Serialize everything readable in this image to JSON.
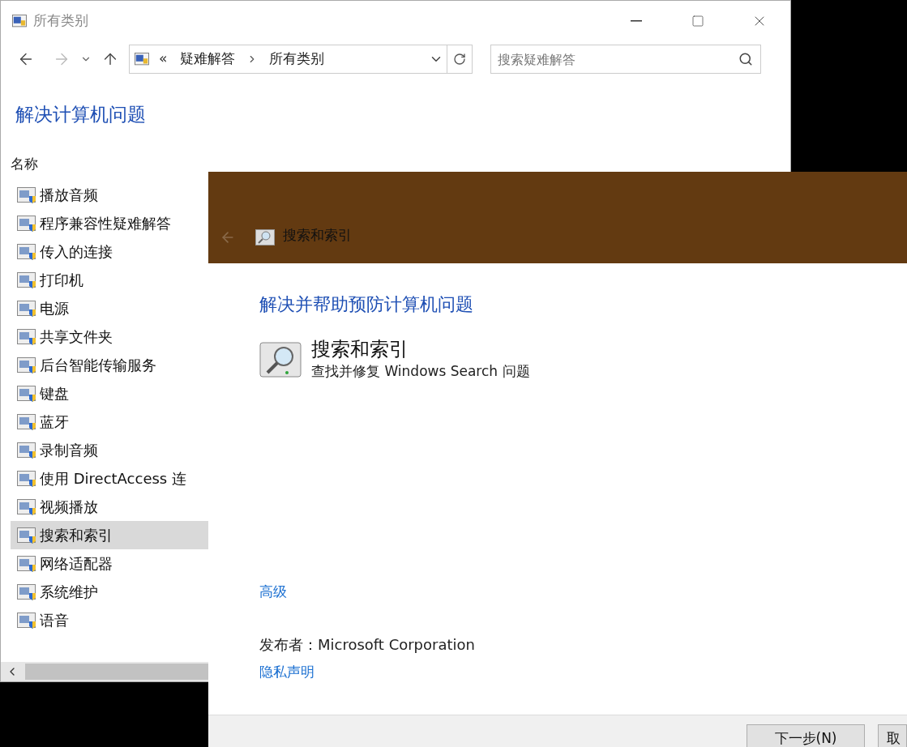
{
  "back_window": {
    "title": "所有类别",
    "address": {
      "overflow": "«",
      "crumbs": [
        "疑难解答",
        "所有类别"
      ]
    },
    "search": {
      "placeholder": "搜索疑难解答"
    },
    "heading": "解决计算机问题",
    "column": "名称",
    "items": [
      {
        "label": "播放音频",
        "selected": false
      },
      {
        "label": "程序兼容性疑难解答",
        "selected": false
      },
      {
        "label": "传入的连接",
        "selected": false
      },
      {
        "label": "打印机",
        "selected": false
      },
      {
        "label": "电源",
        "selected": false
      },
      {
        "label": "共享文件夹",
        "selected": false
      },
      {
        "label": "后台智能传输服务",
        "selected": false
      },
      {
        "label": "键盘",
        "selected": false
      },
      {
        "label": "蓝牙",
        "selected": false
      },
      {
        "label": "录制音频",
        "selected": false
      },
      {
        "label": "使用 DirectAccess 连",
        "selected": false
      },
      {
        "label": "视频播放",
        "selected": false
      },
      {
        "label": "搜索和索引",
        "selected": true
      },
      {
        "label": "网络适配器",
        "selected": false
      },
      {
        "label": "系统维护",
        "selected": false
      },
      {
        "label": "语音",
        "selected": false
      }
    ]
  },
  "dialog": {
    "title": "搜索和索引",
    "heading": "解决并帮助预防计算机问题",
    "tool": {
      "name": "搜索和索引",
      "description": "查找并修复 Windows Search 问题"
    },
    "advanced_link": "高级",
    "publisher": "发布者：Microsoft Corporation",
    "privacy_link": "隐私声明",
    "buttons": [
      "下一步(N)",
      "取"
    ]
  }
}
